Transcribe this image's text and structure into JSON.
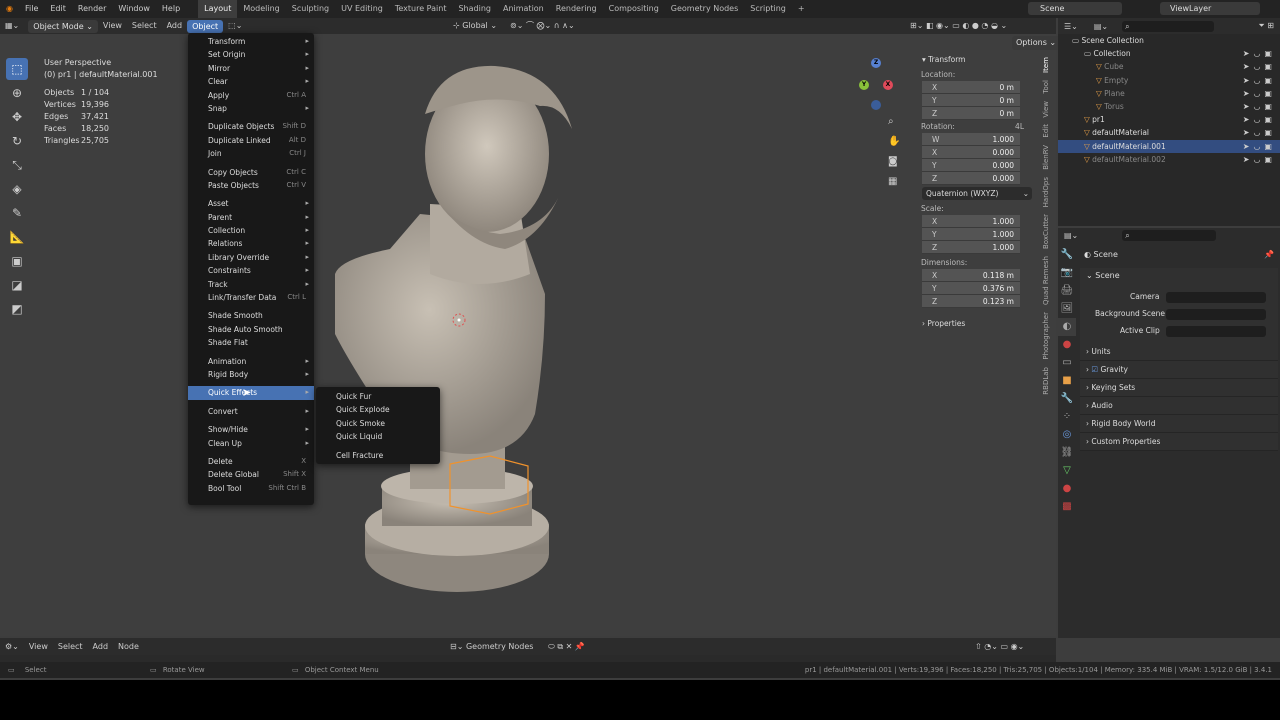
{
  "topbar": {
    "menus": [
      "File",
      "Edit",
      "Render",
      "Window",
      "Help"
    ],
    "workspaces": [
      "Layout",
      "Modeling",
      "Sculpting",
      "UV Editing",
      "Texture Paint",
      "Shading",
      "Animation",
      "Rendering",
      "Compositing",
      "Geometry Nodes",
      "Scripting"
    ],
    "active_workspace": "Layout",
    "scene": "Scene",
    "view_layer": "ViewLayer"
  },
  "viewport_header": {
    "mode": "Object Mode",
    "menus": [
      "View",
      "Select",
      "Add",
      "Object"
    ],
    "transform_orientation": "Global",
    "options": "Options"
  },
  "overlay_info": {
    "view": "User Perspective",
    "object": "(0) pr1 | defaultMaterial.001",
    "stats": [
      {
        "label": "Objects",
        "value": "1 / 104"
      },
      {
        "label": "Vertices",
        "value": "19,396"
      },
      {
        "label": "Edges",
        "value": "37,421"
      },
      {
        "label": "Faces",
        "value": "18,250"
      },
      {
        "label": "Triangles",
        "value": "25,705"
      }
    ]
  },
  "object_menu": [
    {
      "label": "Transform",
      "arrow": true
    },
    {
      "label": "Set Origin",
      "arrow": true
    },
    {
      "label": "Mirror",
      "arrow": true
    },
    {
      "label": "Clear",
      "arrow": true
    },
    {
      "label": "Apply",
      "shortcut": "Ctrl A"
    },
    {
      "label": "Snap",
      "arrow": true
    },
    {
      "sep": true
    },
    {
      "label": "Duplicate Objects",
      "shortcut": "Shift D"
    },
    {
      "label": "Duplicate Linked",
      "shortcut": "Alt D"
    },
    {
      "label": "Join",
      "shortcut": "Ctrl J"
    },
    {
      "sep": true
    },
    {
      "label": "Copy Objects",
      "shortcut": "Ctrl C"
    },
    {
      "label": "Paste Objects",
      "shortcut": "Ctrl V"
    },
    {
      "sep": true
    },
    {
      "label": "Asset",
      "arrow": true
    },
    {
      "label": "Parent",
      "arrow": true
    },
    {
      "label": "Collection",
      "arrow": true
    },
    {
      "label": "Relations",
      "arrow": true
    },
    {
      "label": "Library Override",
      "arrow": true
    },
    {
      "label": "Constraints",
      "arrow": true
    },
    {
      "label": "Track",
      "arrow": true
    },
    {
      "label": "Link/Transfer Data",
      "shortcut": "Ctrl L"
    },
    {
      "sep": true
    },
    {
      "label": "Shade Smooth"
    },
    {
      "label": "Shade Auto Smooth"
    },
    {
      "label": "Shade Flat"
    },
    {
      "sep": true
    },
    {
      "label": "Animation",
      "arrow": true
    },
    {
      "label": "Rigid Body",
      "arrow": true
    },
    {
      "sep": true
    },
    {
      "label": "Quick Effects",
      "arrow": true,
      "highlight": true
    },
    {
      "sep": true
    },
    {
      "label": "Convert",
      "arrow": true
    },
    {
      "sep": true
    },
    {
      "label": "Show/Hide",
      "arrow": true
    },
    {
      "label": "Clean Up",
      "arrow": true
    },
    {
      "sep": true
    },
    {
      "label": "Delete",
      "shortcut": "X"
    },
    {
      "label": "Delete Global",
      "shortcut": "Shift X"
    },
    {
      "label": "Bool Tool",
      "shortcut": "Shift Ctrl B"
    }
  ],
  "quick_effects": [
    "Quick Fur",
    "Quick Explode",
    "Quick Smoke",
    "Quick Liquid",
    "Cell Fracture"
  ],
  "npanel": {
    "title": "Transform",
    "location_label": "Location:",
    "location": [
      {
        "a": "X",
        "v": "0 m"
      },
      {
        "a": "Y",
        "v": "0 m"
      },
      {
        "a": "Z",
        "v": "0 m"
      }
    ],
    "rotation_label": "Rotation:",
    "rotation_mode_short": "4L",
    "rotation": [
      {
        "a": "W",
        "v": "1.000"
      },
      {
        "a": "X",
        "v": "0.000"
      },
      {
        "a": "Y",
        "v": "0.000"
      },
      {
        "a": "Z",
        "v": "0.000"
      }
    ],
    "rotation_mode": "Quaternion (WXYZ)",
    "scale_label": "Scale:",
    "scale": [
      {
        "a": "X",
        "v": "1.000"
      },
      {
        "a": "Y",
        "v": "1.000"
      },
      {
        "a": "Z",
        "v": "1.000"
      }
    ],
    "dimensions_label": "Dimensions:",
    "dimensions": [
      {
        "a": "X",
        "v": "0.118 m"
      },
      {
        "a": "Y",
        "v": "0.376 m"
      },
      {
        "a": "Z",
        "v": "0.123 m"
      }
    ],
    "properties": "Properties",
    "tabs": [
      "Item",
      "Tool",
      "View",
      "Edit",
      "BlenRV",
      "HardOps",
      "BoxCutter",
      "Quad Remesh",
      "Photographer",
      "RBDLab"
    ]
  },
  "outliner": {
    "items": [
      {
        "label": "Scene Collection",
        "indent": 0
      },
      {
        "label": "Collection",
        "indent": 1
      },
      {
        "label": "Cube",
        "indent": 2,
        "dim": true
      },
      {
        "label": "Empty",
        "indent": 2,
        "dim": true
      },
      {
        "label": "Plane",
        "indent": 2,
        "dim": true
      },
      {
        "label": "Torus",
        "indent": 2,
        "dim": true
      },
      {
        "label": "pr1",
        "indent": 1
      },
      {
        "label": "defaultMaterial",
        "indent": 1
      },
      {
        "label": "defaultMaterial.001",
        "indent": 1,
        "selected": true
      },
      {
        "label": "defaultMaterial.002",
        "indent": 1,
        "dim": true
      }
    ]
  },
  "properties": {
    "title": "Scene",
    "section": "Scene",
    "camera_label": "Camera",
    "background_label": "Background Scene",
    "clip_label": "Active Clip",
    "panels": [
      "Units",
      "Gravity",
      "Keying Sets",
      "Audio",
      "Rigid Body World",
      "Custom Properties"
    ]
  },
  "footer": {
    "menus": [
      "View",
      "Select",
      "Add",
      "Node"
    ],
    "editor": "Geometry Nodes"
  },
  "statusbar": {
    "left": "Select",
    "mid": "Rotate View",
    "ctx": "Object Context Menu",
    "right": "pr1 | defaultMaterial.001 | Verts:19,396 | Faces:18,250 | Tris:25,705 | Objects:1/104 | Memory: 335.4 MiB | VRAM: 1.5/12.0 GiB | 3.4.1"
  }
}
